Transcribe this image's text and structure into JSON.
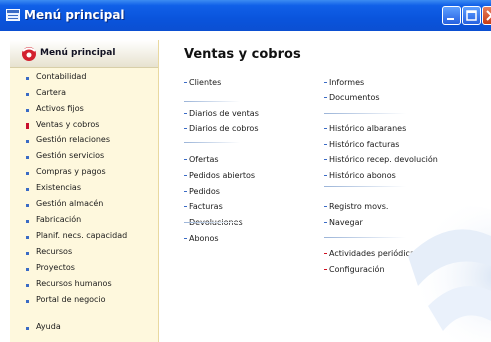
{
  "window": {
    "title": "Menú principal"
  },
  "sidebar": {
    "header": "Menú principal",
    "items": [
      {
        "label": "Contabilidad"
      },
      {
        "label": "Cartera"
      },
      {
        "label": "Activos fijos"
      },
      {
        "label": "Ventas y cobros",
        "active": true
      },
      {
        "label": "Gestión relaciones"
      },
      {
        "label": "Gestión servicios"
      },
      {
        "label": "Compras y pagos"
      },
      {
        "label": "Existencias"
      },
      {
        "label": "Gestión almacén"
      },
      {
        "label": "Fabricación"
      },
      {
        "label": "Planif. necs. capacidad"
      },
      {
        "label": "Recursos"
      },
      {
        "label": "Proyectos"
      },
      {
        "label": "Recursos humanos"
      },
      {
        "label": "Portal de negocio"
      },
      {
        "label": "Ayuda"
      }
    ]
  },
  "main": {
    "title": "Ventas y cobros",
    "left_links": [
      "Clientes",
      "Diarios de ventas",
      "Diarios de cobros",
      "Ofertas",
      "Pedidos abiertos",
      "Pedidos",
      "Facturas",
      "Devoluciones",
      "Abonos"
    ],
    "right_links": [
      "Informes",
      "Documentos",
      "Histórico albaranes",
      "Histórico facturas",
      "Histórico recep. devolución",
      "Histórico abonos",
      "Registro movs.",
      "Navegar",
      "Actividades periódicas",
      "Configuración"
    ]
  },
  "colors": {
    "titlebar": "#0a54dc",
    "sidebar_bg": "#fef8dd",
    "active_bullet": "#c8102e",
    "bullet": "#3a6bc5"
  }
}
